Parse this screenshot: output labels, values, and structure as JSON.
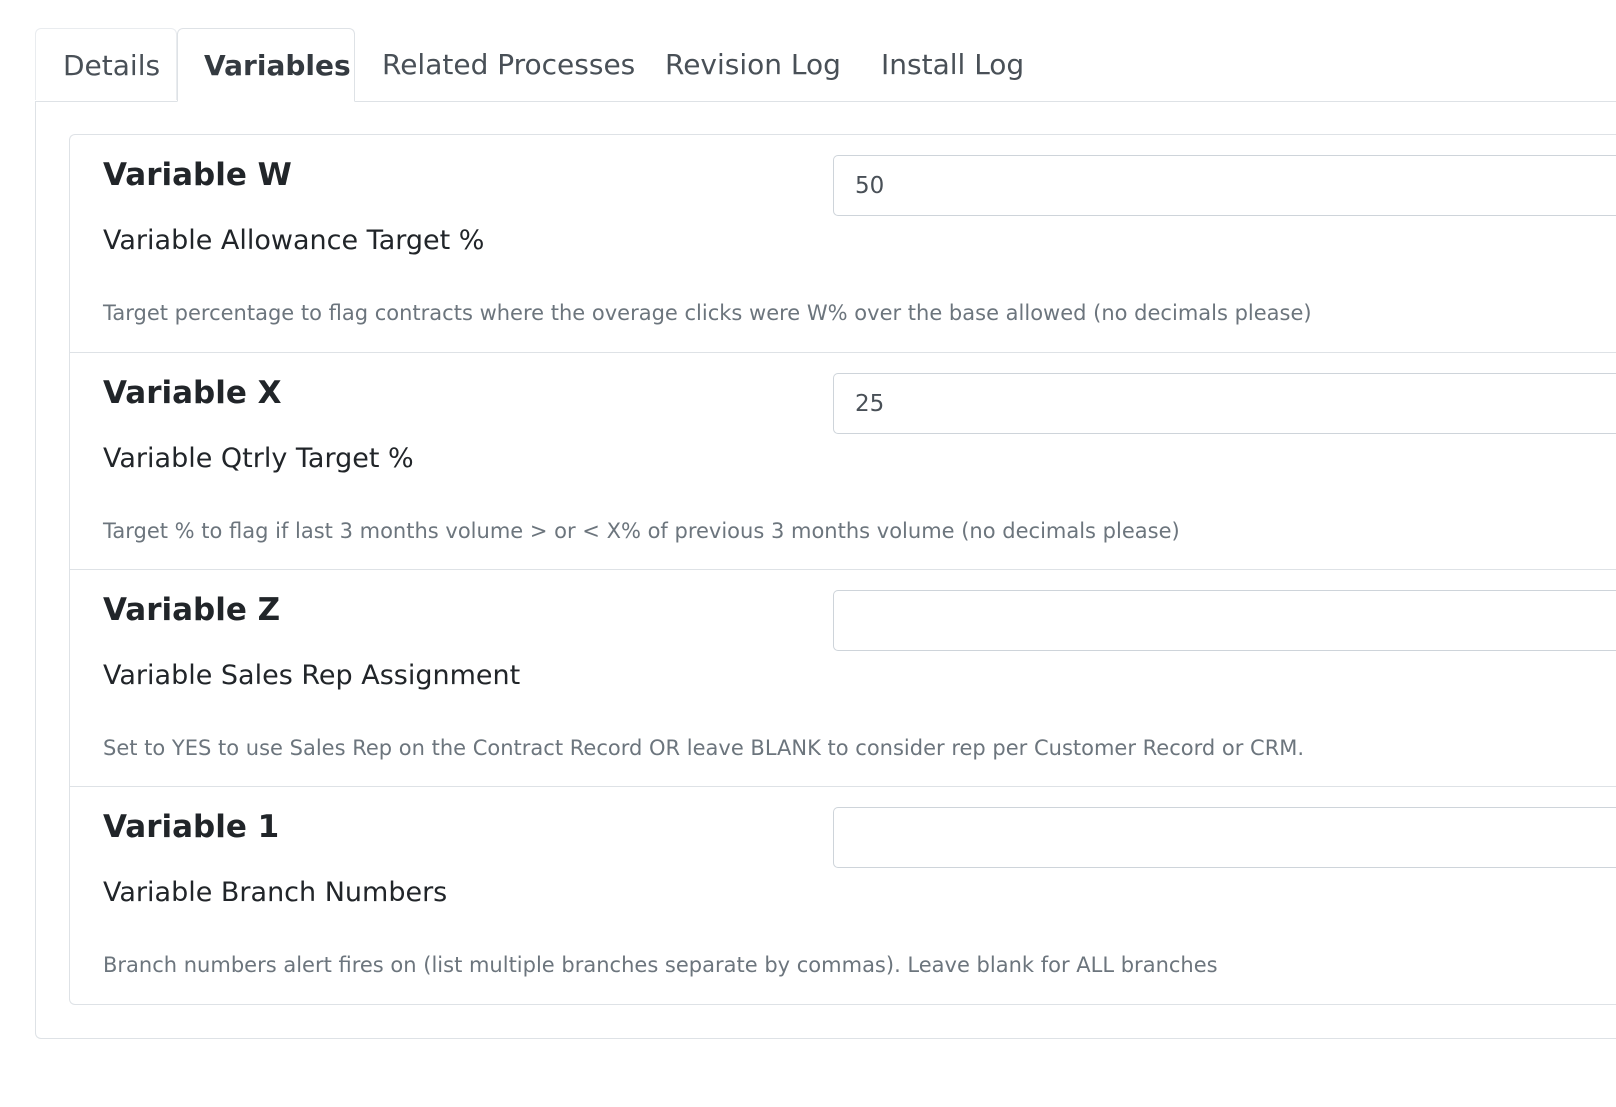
{
  "tabs": [
    {
      "label": "Details",
      "active": false
    },
    {
      "label": "Variables",
      "active": true
    },
    {
      "label": "Related Processes",
      "active": false
    },
    {
      "label": "Revision Log",
      "active": false
    },
    {
      "label": "Install Log",
      "active": false
    }
  ],
  "variables": [
    {
      "name": "Variable W",
      "label": "Variable Allowance Target %",
      "description": "Target percentage to flag contracts where the overage clicks were W% over the base allowed (no decimals please)",
      "value": "50"
    },
    {
      "name": "Variable X",
      "label": "Variable Qtrly Target %",
      "description": "Target % to flag if last 3 months volume > or < X% of previous 3 months volume (no decimals please)",
      "value": "25"
    },
    {
      "name": "Variable Z",
      "label": "Variable Sales Rep Assignment",
      "description": "Set to YES to use Sales Rep on the Contract Record OR leave BLANK to consider rep per Customer Record or CRM.",
      "value": ""
    },
    {
      "name": "Variable 1",
      "label": "Variable Branch Numbers",
      "description": "Branch numbers alert fires on (list multiple branches separate by commas). Leave blank for ALL branches",
      "value": ""
    }
  ]
}
